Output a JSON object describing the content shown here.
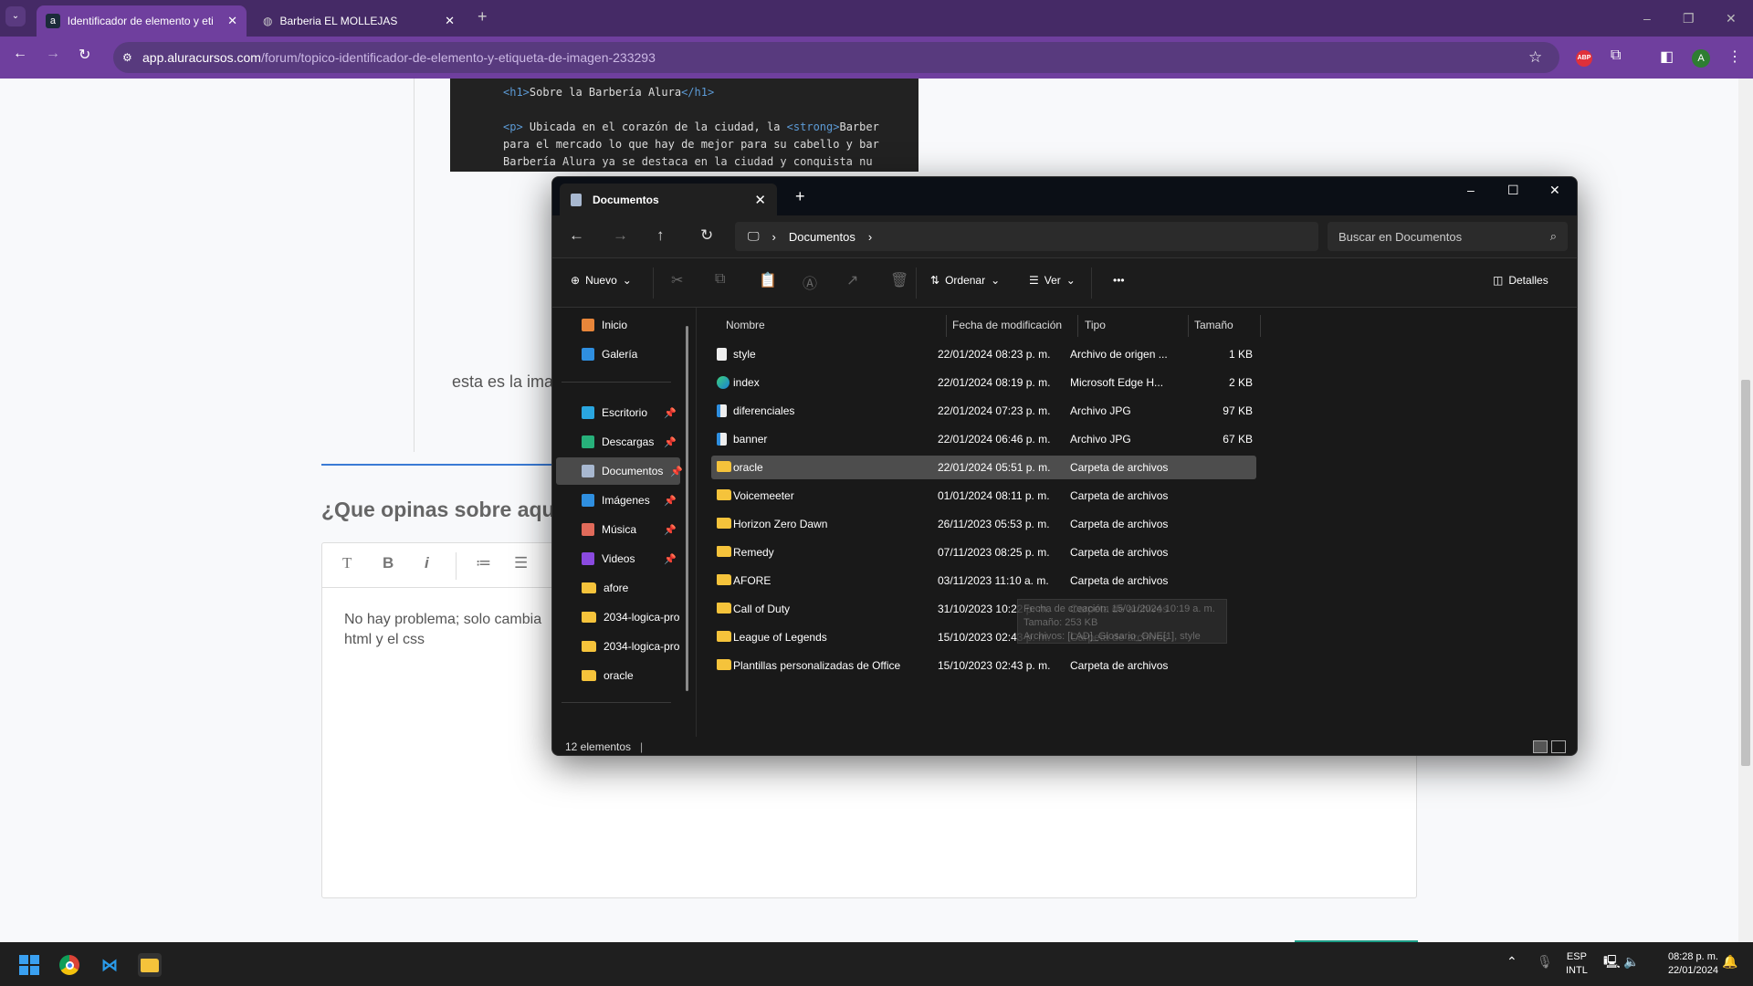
{
  "browser": {
    "tabs": [
      {
        "label": "Identificador de elemento y eti",
        "favicon": "alura-icon",
        "active": true
      },
      {
        "label": "Barberia EL MOLLEJAS",
        "favicon": "globe-icon",
        "active": false
      }
    ],
    "url_host": "app.aluracursos.com",
    "url_path": "/forum/topico-identificador-de-elemento-y-etiqueta-de-imagen-233293",
    "profile_initial": "A",
    "abp_label": "ABP",
    "accent": "#6f3f9e"
  },
  "page": {
    "code_lines": [
      {
        "open": "<h1>",
        "text": "Sobre la Barbería Alura",
        "close": "</h1>"
      },
      {
        "open": "<p>",
        "text": " Ubicada en el corazón de la ciudad, la ",
        "strong": "<strong>",
        "after": "Barber"
      },
      {
        "text": "para el mercado lo que hay de mejor para su cabello y bar"
      },
      {
        "text": "Barbería Alura ya se destaca en la ciudad y conquista nu"
      }
    ],
    "body_text": "esta es la ima",
    "heading": "¿Que opinas sobre aquello",
    "editor_buttons": [
      "T",
      "B",
      "i",
      "≔",
      "☰"
    ],
    "editor_text": [
      "No hay problema; solo cambia",
      "html y el css"
    ]
  },
  "explorer": {
    "tab_title": "Documentos",
    "breadcrumb": "Documentos",
    "search_placeholder": "Buscar en Documentos",
    "commands": {
      "new": "Nuevo",
      "sort": "Ordenar",
      "view": "Ver",
      "more": "•••",
      "details": "Detalles"
    },
    "sidebar": [
      {
        "label": "Inicio",
        "icon": "home-icon"
      },
      {
        "label": "Galería",
        "icon": "gallery-icon"
      },
      {
        "label": "Escritorio",
        "icon": "desktop-icon",
        "pinned": true
      },
      {
        "label": "Descargas",
        "icon": "download-icon",
        "pinned": true
      },
      {
        "label": "Documentos",
        "icon": "documents-icon",
        "pinned": true,
        "selected": true
      },
      {
        "label": "Imágenes",
        "icon": "pictures-icon",
        "pinned": true
      },
      {
        "label": "Música",
        "icon": "music-icon",
        "pinned": true
      },
      {
        "label": "Videos",
        "icon": "videos-icon",
        "pinned": true
      },
      {
        "label": "afore",
        "icon": "folder-icon"
      },
      {
        "label": "2034-logica-pro",
        "icon": "folder-icon"
      },
      {
        "label": "2034-logica-pro",
        "icon": "folder-icon"
      },
      {
        "label": "oracle",
        "icon": "folder-icon"
      }
    ],
    "columns": [
      "Nombre",
      "Fecha de modificación",
      "Tipo",
      "Tamaño"
    ],
    "files": [
      {
        "name": "style",
        "date": "22/01/2024 08:23 p. m.",
        "type": "Archivo de origen ...",
        "size": "1 KB",
        "icon": "css-file-icon"
      },
      {
        "name": "index",
        "date": "22/01/2024 08:19 p. m.",
        "type": "Microsoft Edge H...",
        "size": "2 KB",
        "icon": "edge-icon"
      },
      {
        "name": "diferenciales",
        "date": "22/01/2024 07:23 p. m.",
        "type": "Archivo JPG",
        "size": "97 KB",
        "icon": "image-file-icon"
      },
      {
        "name": "banner",
        "date": "22/01/2024 06:46 p. m.",
        "type": "Archivo JPG",
        "size": "67 KB",
        "icon": "image-file-icon"
      },
      {
        "name": "oracle",
        "date": "22/01/2024 05:51 p. m.",
        "type": "Carpeta de archivos",
        "size": "",
        "icon": "folder-icon",
        "selected": true
      },
      {
        "name": "Voicemeeter",
        "date": "01/01/2024 08:11 p. m.",
        "type": "Carpeta de archivos",
        "size": "",
        "icon": "folder-icon"
      },
      {
        "name": "Horizon Zero Dawn",
        "date": "26/11/2023 05:53 p. m.",
        "type": "Carpeta de archivos",
        "size": "",
        "icon": "folder-icon"
      },
      {
        "name": "Remedy",
        "date": "07/11/2023 08:25 p. m.",
        "type": "Carpeta de archivos",
        "size": "",
        "icon": "folder-icon"
      },
      {
        "name": "AFORE",
        "date": "03/11/2023 11:10 a. m.",
        "type": "Carpeta de archivos",
        "size": "",
        "icon": "folder-icon"
      },
      {
        "name": "Call of Duty",
        "date": "31/10/2023 10:22 p. m.",
        "type": "Carpeta de archivos",
        "size": "",
        "icon": "folder-icon"
      },
      {
        "name": "League of Legends",
        "date": "15/10/2023 02:43 p. m.",
        "type": "Carpeta de archivos",
        "size": "",
        "icon": "folder-icon"
      },
      {
        "name": "Plantillas personalizadas de Office",
        "date": "15/10/2023 02:43 p. m.",
        "type": "Carpeta de archivos",
        "size": "",
        "icon": "folder-icon"
      }
    ],
    "tooltip": [
      "Fecha de creación: 15/01/2024 10:19 a. m.",
      "Tamaño: 253 KB",
      "Archivos: [LAD]_Glosario_ONE[1], style"
    ],
    "status": "12 elementos"
  },
  "taskbar": {
    "lang1": "ESP",
    "lang2": "INTL",
    "time": "08:28 p. m.",
    "date": "22/01/2024"
  }
}
